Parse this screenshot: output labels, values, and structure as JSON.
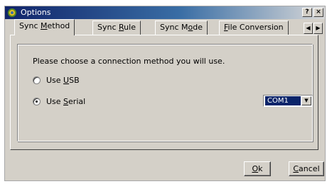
{
  "window": {
    "title": "Options",
    "help_glyph": "?",
    "close_glyph": "×"
  },
  "tabs": [
    {
      "label_pre": "Sync ",
      "label_key": "M",
      "label_post": "ethod",
      "active": true
    },
    {
      "label_pre": "Sync ",
      "label_key": "R",
      "label_post": "ule",
      "active": false
    },
    {
      "label_pre": "Sync M",
      "label_key": "o",
      "label_post": "de",
      "active": false
    },
    {
      "label_pre": "",
      "label_key": "F",
      "label_post": "ile Conversion",
      "active": false
    }
  ],
  "tab_scroll": {
    "left_glyph": "◀",
    "right_glyph": "▶"
  },
  "sync_method": {
    "prompt": "Please choose a connection method you will use.",
    "options": [
      {
        "label_pre": "Use ",
        "label_key": "U",
        "label_post": "SB",
        "checked": false
      },
      {
        "label_pre": "Use ",
        "label_key": "S",
        "label_post": "erial",
        "checked": true
      }
    ],
    "port_select": {
      "value": "COM1",
      "arrow_glyph": "▼"
    }
  },
  "buttons": {
    "ok": {
      "label_key": "O",
      "label_post": "k"
    },
    "cancel": {
      "label_key": "C",
      "label_post": "ancel"
    }
  },
  "colors": {
    "titlebar_start": "#10246a",
    "titlebar_end": "#d8d8d8",
    "dialog_face": "#d4d0c8",
    "selection": "#0a246a"
  }
}
